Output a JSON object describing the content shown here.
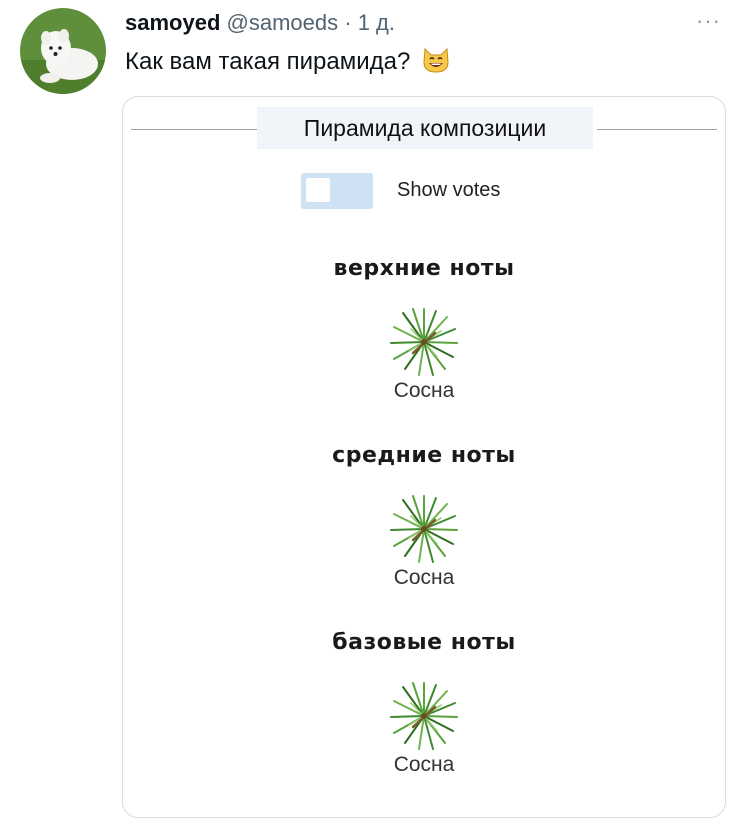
{
  "tweet": {
    "author_name": "samoyed",
    "handle": "@samoeds",
    "separator": "·",
    "time": "1 д.",
    "more_label": "···",
    "text": "Как вам такая пирамида?",
    "emoji_icon": "grinning-cat-emoji",
    "avatar_icon": "samoyed-dog-avatar"
  },
  "card": {
    "title": "Пирамида композиции",
    "toggle_label": "Show votes",
    "toggle_on": false,
    "sections": [
      {
        "title": "верхние ноты",
        "notes": [
          {
            "label": "Сосна",
            "icon": "pine-branch-icon"
          }
        ]
      },
      {
        "title": "средние ноты",
        "notes": [
          {
            "label": "Сосна",
            "icon": "pine-branch-icon"
          }
        ]
      },
      {
        "title": "базовые ноты",
        "notes": [
          {
            "label": "Сосна",
            "icon": "pine-branch-icon"
          }
        ]
      }
    ]
  },
  "colors": {
    "toggle_track": "#cfe2f3",
    "title_bg": "#f1f4f8",
    "muted_text": "#536471",
    "pine_green": "#3f8a2e"
  }
}
